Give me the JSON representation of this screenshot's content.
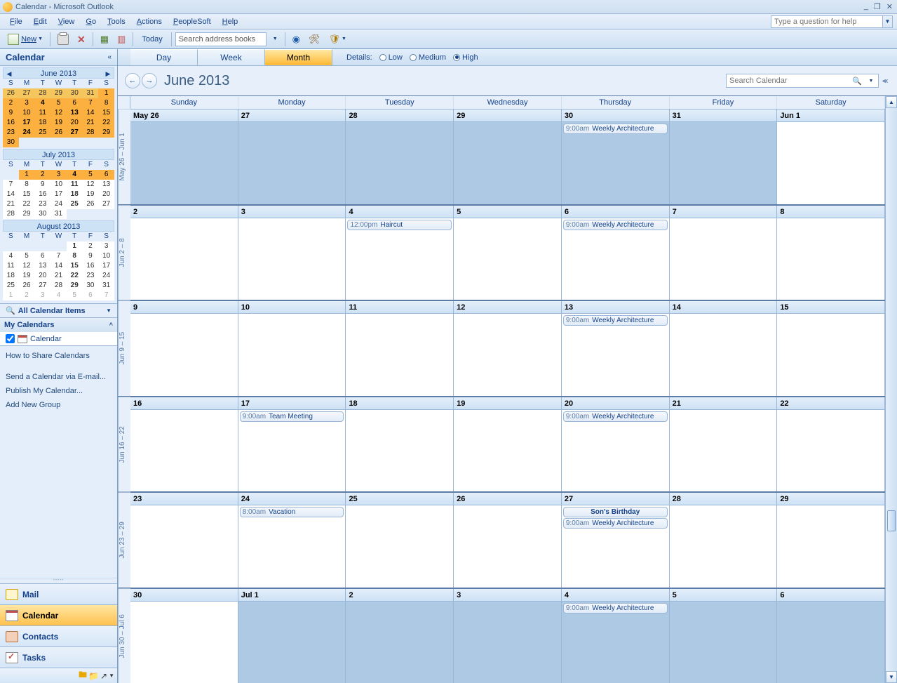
{
  "window": {
    "title": "Calendar - Microsoft Outlook"
  },
  "menu": [
    "File",
    "Edit",
    "View",
    "Go",
    "Tools",
    "Actions",
    "PeopleSoft",
    "Help"
  ],
  "help_placeholder": "Type a question for help",
  "toolbar": {
    "new_label": "New",
    "today_label": "Today",
    "search_value": "Search address books"
  },
  "sidebar": {
    "title": "Calendar",
    "all_items": "All Calendar Items",
    "my_calendars": "My Calendars",
    "calendar_item": "Calendar",
    "links": [
      "How to Share Calendars",
      "Send a Calendar via E-mail...",
      "Publish My Calendar...",
      "Add New Group"
    ],
    "nav": [
      "Mail",
      "Calendar",
      "Contacts",
      "Tasks"
    ]
  },
  "minis": [
    {
      "title": "June 2013",
      "show_nav": true,
      "dow": [
        "S",
        "M",
        "T",
        "W",
        "T",
        "F",
        "S"
      ],
      "cells": [
        {
          "n": "26",
          "c": "prev"
        },
        {
          "n": "27",
          "c": "prev"
        },
        {
          "n": "28",
          "c": "prev"
        },
        {
          "n": "29",
          "c": "prev"
        },
        {
          "n": "30",
          "c": "prev"
        },
        {
          "n": "31",
          "c": "prev"
        },
        {
          "n": "1",
          "c": "hl"
        },
        {
          "n": "2",
          "c": "hl"
        },
        {
          "n": "3",
          "c": "hl"
        },
        {
          "n": "4",
          "c": "hl bold"
        },
        {
          "n": "5",
          "c": "hl"
        },
        {
          "n": "6",
          "c": "hl"
        },
        {
          "n": "7",
          "c": "hl"
        },
        {
          "n": "8",
          "c": "hl"
        },
        {
          "n": "9",
          "c": "hl"
        },
        {
          "n": "10",
          "c": "hl"
        },
        {
          "n": "11",
          "c": "hl"
        },
        {
          "n": "12",
          "c": "hl"
        },
        {
          "n": "13",
          "c": "hl bold"
        },
        {
          "n": "14",
          "c": "hl"
        },
        {
          "n": "15",
          "c": "hl"
        },
        {
          "n": "16",
          "c": "hl"
        },
        {
          "n": "17",
          "c": "hl bold"
        },
        {
          "n": "18",
          "c": "hl"
        },
        {
          "n": "19",
          "c": "hl"
        },
        {
          "n": "20",
          "c": "hl"
        },
        {
          "n": "21",
          "c": "hl"
        },
        {
          "n": "22",
          "c": "hl"
        },
        {
          "n": "23",
          "c": "hl"
        },
        {
          "n": "24",
          "c": "hl bold"
        },
        {
          "n": "25",
          "c": "hl"
        },
        {
          "n": "26",
          "c": "hl"
        },
        {
          "n": "27",
          "c": "hl bold"
        },
        {
          "n": "28",
          "c": "hl"
        },
        {
          "n": "29",
          "c": "hl"
        },
        {
          "n": "30",
          "c": "hl"
        },
        {
          "n": "",
          "c": "empty"
        },
        {
          "n": "",
          "c": "empty"
        },
        {
          "n": "",
          "c": "empty"
        },
        {
          "n": "",
          "c": "empty"
        },
        {
          "n": "",
          "c": "empty"
        },
        {
          "n": "",
          "c": "empty"
        }
      ]
    },
    {
      "title": "July 2013",
      "show_nav": false,
      "dow": [
        "S",
        "M",
        "T",
        "W",
        "T",
        "F",
        "S"
      ],
      "cells": [
        {
          "n": "",
          "c": "empty"
        },
        {
          "n": "1",
          "c": "hl"
        },
        {
          "n": "2",
          "c": "hl"
        },
        {
          "n": "3",
          "c": "hl"
        },
        {
          "n": "4",
          "c": "hl bold"
        },
        {
          "n": "5",
          "c": "hl"
        },
        {
          "n": "6",
          "c": "hl"
        },
        {
          "n": "7",
          "c": "norm"
        },
        {
          "n": "8",
          "c": "norm"
        },
        {
          "n": "9",
          "c": "norm"
        },
        {
          "n": "10",
          "c": "norm"
        },
        {
          "n": "11",
          "c": "norm bold"
        },
        {
          "n": "12",
          "c": "norm"
        },
        {
          "n": "13",
          "c": "norm"
        },
        {
          "n": "14",
          "c": "norm"
        },
        {
          "n": "15",
          "c": "norm"
        },
        {
          "n": "16",
          "c": "norm"
        },
        {
          "n": "17",
          "c": "norm"
        },
        {
          "n": "18",
          "c": "norm bold"
        },
        {
          "n": "19",
          "c": "norm"
        },
        {
          "n": "20",
          "c": "norm"
        },
        {
          "n": "21",
          "c": "norm"
        },
        {
          "n": "22",
          "c": "norm"
        },
        {
          "n": "23",
          "c": "norm"
        },
        {
          "n": "24",
          "c": "norm"
        },
        {
          "n": "25",
          "c": "norm bold"
        },
        {
          "n": "26",
          "c": "norm"
        },
        {
          "n": "27",
          "c": "norm"
        },
        {
          "n": "28",
          "c": "norm"
        },
        {
          "n": "29",
          "c": "norm"
        },
        {
          "n": "30",
          "c": "norm"
        },
        {
          "n": "31",
          "c": "norm"
        },
        {
          "n": "",
          "c": "empty"
        },
        {
          "n": "",
          "c": "empty"
        },
        {
          "n": "",
          "c": "empty"
        }
      ]
    },
    {
      "title": "August 2013",
      "show_nav": false,
      "dow": [
        "S",
        "M",
        "T",
        "W",
        "T",
        "F",
        "S"
      ],
      "cells": [
        {
          "n": "",
          "c": "empty"
        },
        {
          "n": "",
          "c": "empty"
        },
        {
          "n": "",
          "c": "empty"
        },
        {
          "n": "",
          "c": "empty"
        },
        {
          "n": "1",
          "c": "norm bold"
        },
        {
          "n": "2",
          "c": "norm"
        },
        {
          "n": "3",
          "c": "norm"
        },
        {
          "n": "4",
          "c": "norm"
        },
        {
          "n": "5",
          "c": "norm"
        },
        {
          "n": "6",
          "c": "norm"
        },
        {
          "n": "7",
          "c": "norm"
        },
        {
          "n": "8",
          "c": "norm bold"
        },
        {
          "n": "9",
          "c": "norm"
        },
        {
          "n": "10",
          "c": "norm"
        },
        {
          "n": "11",
          "c": "norm"
        },
        {
          "n": "12",
          "c": "norm"
        },
        {
          "n": "13",
          "c": "norm"
        },
        {
          "n": "14",
          "c": "norm"
        },
        {
          "n": "15",
          "c": "norm bold"
        },
        {
          "n": "16",
          "c": "norm"
        },
        {
          "n": "17",
          "c": "norm"
        },
        {
          "n": "18",
          "c": "norm"
        },
        {
          "n": "19",
          "c": "norm"
        },
        {
          "n": "20",
          "c": "norm"
        },
        {
          "n": "21",
          "c": "norm"
        },
        {
          "n": "22",
          "c": "norm bold"
        },
        {
          "n": "23",
          "c": "norm"
        },
        {
          "n": "24",
          "c": "norm"
        },
        {
          "n": "25",
          "c": "norm"
        },
        {
          "n": "26",
          "c": "norm"
        },
        {
          "n": "27",
          "c": "norm"
        },
        {
          "n": "28",
          "c": "norm"
        },
        {
          "n": "29",
          "c": "norm bold"
        },
        {
          "n": "30",
          "c": "norm"
        },
        {
          "n": "31",
          "c": "norm"
        },
        {
          "n": "1",
          "c": "next"
        },
        {
          "n": "2",
          "c": "next"
        },
        {
          "n": "3",
          "c": "next"
        },
        {
          "n": "4",
          "c": "next"
        },
        {
          "n": "5",
          "c": "next"
        },
        {
          "n": "6",
          "c": "next"
        },
        {
          "n": "7",
          "c": "next"
        }
      ]
    }
  ],
  "view": {
    "tabs": [
      "Day",
      "Week",
      "Month"
    ],
    "active": "Month",
    "details_label": "Details:",
    "detail_levels": [
      "Low",
      "Medium",
      "High"
    ],
    "detail_selected": "High"
  },
  "month_header": {
    "title": "June 2013",
    "search_placeholder": "Search Calendar"
  },
  "dow": [
    "Sunday",
    "Monday",
    "Tuesday",
    "Wednesday",
    "Thursday",
    "Friday",
    "Saturday"
  ],
  "weeks": [
    {
      "label": "May 26 – Jun 1",
      "days": [
        {
          "hdr": "May 26",
          "off": true,
          "bold": true
        },
        {
          "hdr": "27",
          "off": true,
          "bold": true
        },
        {
          "hdr": "28",
          "off": true,
          "bold": true
        },
        {
          "hdr": "29",
          "off": true,
          "bold": true
        },
        {
          "hdr": "30",
          "off": true,
          "bold": true,
          "events": [
            {
              "time": "9:00am",
              "subj": "Weekly Architecture"
            }
          ]
        },
        {
          "hdr": "31",
          "off": true,
          "bold": true
        },
        {
          "hdr": "Jun 1",
          "bold": true
        }
      ]
    },
    {
      "label": "Jun 2 – 8",
      "days": [
        {
          "hdr": "2",
          "bold": true
        },
        {
          "hdr": "3",
          "bold": true
        },
        {
          "hdr": "4",
          "bold": true,
          "events": [
            {
              "time": "12:00pm",
              "subj": "Haircut"
            }
          ]
        },
        {
          "hdr": "5",
          "bold": true
        },
        {
          "hdr": "6",
          "bold": true,
          "events": [
            {
              "time": "9:00am",
              "subj": "Weekly Architecture"
            }
          ]
        },
        {
          "hdr": "7",
          "bold": true
        },
        {
          "hdr": "8",
          "bold": true
        }
      ]
    },
    {
      "label": "Jun 9 – 15",
      "days": [
        {
          "hdr": "9",
          "bold": true
        },
        {
          "hdr": "10",
          "bold": true
        },
        {
          "hdr": "11",
          "bold": true
        },
        {
          "hdr": "12",
          "bold": true
        },
        {
          "hdr": "13",
          "bold": true,
          "events": [
            {
              "time": "9:00am",
              "subj": "Weekly Architecture"
            }
          ]
        },
        {
          "hdr": "14",
          "bold": true
        },
        {
          "hdr": "15",
          "bold": true
        }
      ]
    },
    {
      "label": "Jun 16 – 22",
      "days": [
        {
          "hdr": "16",
          "bold": true
        },
        {
          "hdr": "17",
          "bold": true,
          "events": [
            {
              "time": "9:00am",
              "subj": "Team Meeting"
            }
          ]
        },
        {
          "hdr": "18",
          "bold": true
        },
        {
          "hdr": "19",
          "bold": true
        },
        {
          "hdr": "20",
          "bold": true,
          "events": [
            {
              "time": "9:00am",
              "subj": "Weekly Architecture"
            }
          ]
        },
        {
          "hdr": "21",
          "bold": true
        },
        {
          "hdr": "22",
          "bold": true
        }
      ]
    },
    {
      "label": "Jun 23 – 29",
      "days": [
        {
          "hdr": "23",
          "bold": true
        },
        {
          "hdr": "24",
          "bold": true,
          "events": [
            {
              "time": "8:00am",
              "subj": "Vacation"
            }
          ]
        },
        {
          "hdr": "25",
          "bold": true
        },
        {
          "hdr": "26",
          "bold": true
        },
        {
          "hdr": "27",
          "bold": true,
          "events": [
            {
              "allday": true,
              "subj": "Son's Birthday"
            },
            {
              "time": "9:00am",
              "subj": "Weekly Architecture"
            }
          ]
        },
        {
          "hdr": "28",
          "bold": true
        },
        {
          "hdr": "29",
          "bold": true
        }
      ]
    },
    {
      "label": "Jun 30 – Jul 6",
      "days": [
        {
          "hdr": "30",
          "bold": true
        },
        {
          "hdr": "Jul 1",
          "off": true,
          "bold": true
        },
        {
          "hdr": "2",
          "off": true,
          "bold": true
        },
        {
          "hdr": "3",
          "off": true,
          "bold": true
        },
        {
          "hdr": "4",
          "off": true,
          "bold": true,
          "events": [
            {
              "time": "9:00am",
              "subj": "Weekly Architecture"
            }
          ]
        },
        {
          "hdr": "5",
          "off": true,
          "bold": true
        },
        {
          "hdr": "6",
          "off": true,
          "bold": true
        }
      ]
    }
  ]
}
